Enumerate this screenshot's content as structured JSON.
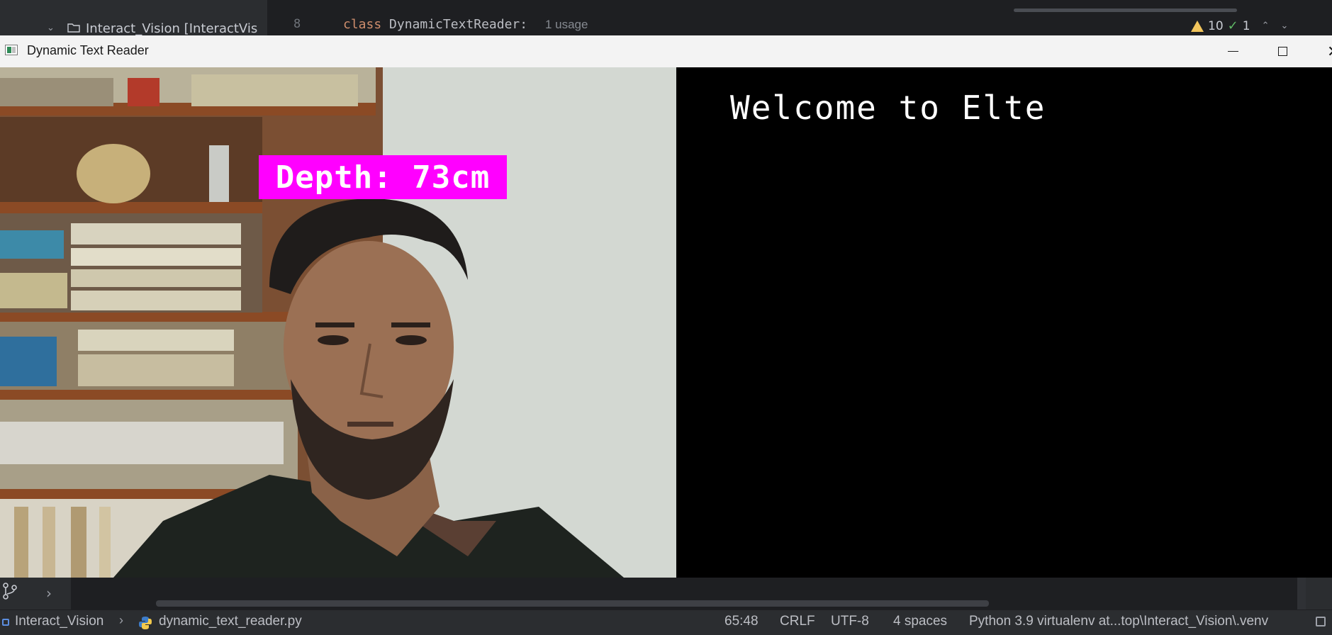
{
  "ide": {
    "project_label": "Interact_Vision [InteractVis",
    "line_number": "8",
    "code_keyword": "class",
    "code_classname": "DynamicTextReader:",
    "usage_hint": "1 usage",
    "warning_count": "10",
    "ok_count": "1"
  },
  "window": {
    "title": "Dynamic Text Reader",
    "minimize_symbol": "—",
    "close_symbol": "✕"
  },
  "camera": {
    "depth_label": "Depth: 73cm",
    "overlay_color": "#ff00ff"
  },
  "text_panel": {
    "welcome_text": "Welcome to Elte"
  },
  "status_bar": {
    "project": "Interact_Vision",
    "file": "dynamic_text_reader.py",
    "cursor_position": "65:48",
    "line_endings": "CRLF",
    "encoding": "UTF-8",
    "indent": "4 spaces",
    "interpreter": "Python 3.9 virtualenv at...top\\Interact_Vision\\.venv"
  },
  "colors": {
    "ide_background": "#1e1f22",
    "ide_panel": "#2b2d30",
    "title_bar": "#f3f3f3",
    "keyword": "#cf8e6d",
    "warning": "#f2c55c",
    "ok": "#5fb865"
  }
}
